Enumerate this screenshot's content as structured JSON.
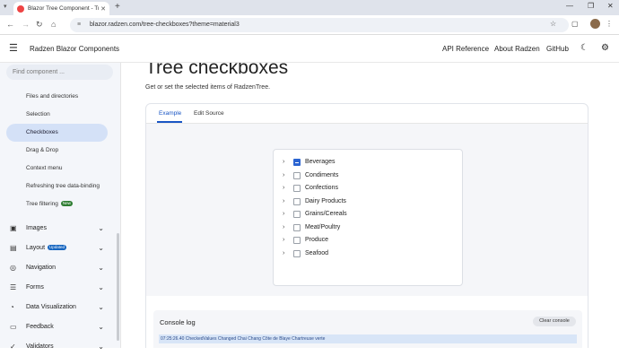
{
  "browser": {
    "tab_title": "Blazor Tree Component - Tri-st...",
    "tab_close": "✕",
    "new_tab": "+",
    "url": "blazor.radzen.com/tree-checkboxes?theme=material3",
    "win_min": "—",
    "win_max": "❐",
    "win_close": "✕"
  },
  "header": {
    "brand": "Radzen Blazor Components",
    "links": [
      "API Reference",
      "About Radzen",
      "GitHub"
    ]
  },
  "sidebar": {
    "search_placeholder": "Find component ...",
    "items": [
      {
        "label": "Files and directories"
      },
      {
        "label": "Selection"
      },
      {
        "label": "Checkboxes",
        "active": true
      },
      {
        "label": "Drag & Drop"
      },
      {
        "label": "Context menu"
      },
      {
        "label": "Refreshing tree data-binding"
      },
      {
        "label": "Tree filtering",
        "badge": "New"
      }
    ],
    "groups": [
      {
        "label": "Images"
      },
      {
        "label": "Layout",
        "badge": "Updated"
      },
      {
        "label": "Navigation"
      },
      {
        "label": "Forms"
      },
      {
        "label": "Data Visualization"
      },
      {
        "label": "Feedback"
      },
      {
        "label": "Validators"
      }
    ]
  },
  "main": {
    "title": "Tree checkboxes",
    "description": "Get or set the selected items of RadzenTree.",
    "tabs": [
      "Example",
      "Edit Source"
    ],
    "tree_nodes": [
      {
        "label": "Beverages",
        "state": "indeterminate"
      },
      {
        "label": "Condiments",
        "state": "unchecked"
      },
      {
        "label": "Confections",
        "state": "unchecked"
      },
      {
        "label": "Dairy Products",
        "state": "unchecked"
      },
      {
        "label": "Grains/Cereals",
        "state": "unchecked"
      },
      {
        "label": "Meat/Poultry",
        "state": "unchecked"
      },
      {
        "label": "Produce",
        "state": "unchecked"
      },
      {
        "label": "Seafood",
        "state": "unchecked"
      }
    ],
    "console": {
      "title": "Console log",
      "clear_label": "Clear console",
      "log": "07:25:26.40 CheckedValues Changed Chai Chang Côte de Blaye Chartreuse verte"
    }
  }
}
